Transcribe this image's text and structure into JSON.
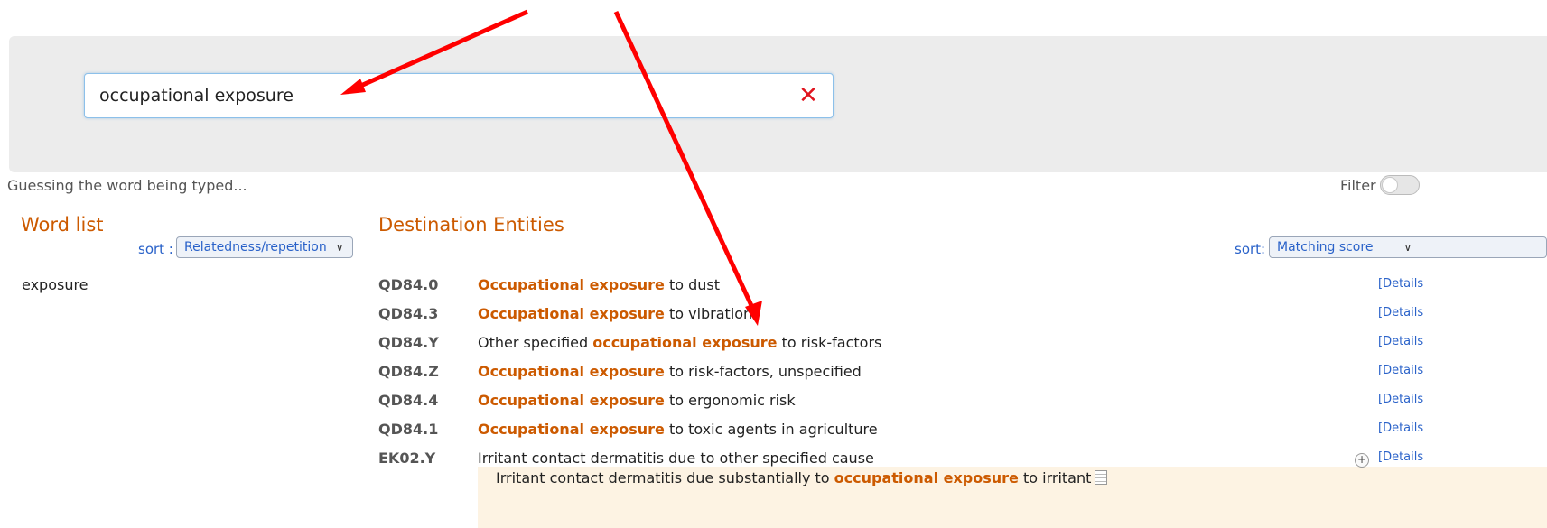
{
  "search": {
    "value": "occupational exposure",
    "clear_icon": "close-icon",
    "clear_glyph": "✕"
  },
  "status": {
    "guess_text": "Guessing the word being typed..."
  },
  "filter": {
    "label": "Filter",
    "enabled": false
  },
  "word_list": {
    "title": "Word list",
    "sort_label": "sort :",
    "sort_value": "Relatedness/repetition",
    "items": [
      "exposure"
    ]
  },
  "entities": {
    "title": "Destination Entities",
    "sort_label": "sort:",
    "sort_value": "Matching score",
    "details_label": "[Details",
    "rows": [
      {
        "code": "QD84.0",
        "pre": "",
        "hl": "Occupational exposure",
        "post": " to dust"
      },
      {
        "code": "QD84.3",
        "pre": "",
        "hl": "Occupational exposure",
        "post": " to vibration"
      },
      {
        "code": "QD84.Y",
        "pre": "Other specified ",
        "hl": "occupational exposure",
        "post": " to risk-factors"
      },
      {
        "code": "QD84.Z",
        "pre": "",
        "hl": "Occupational exposure",
        "post": " to risk-factors, unspecified"
      },
      {
        "code": "QD84.4",
        "pre": "",
        "hl": "Occupational exposure",
        "post": " to ergonomic risk"
      },
      {
        "code": "QD84.1",
        "pre": "",
        "hl": "Occupational exposure",
        "post": " to toxic agents in agriculture"
      },
      {
        "code": "EK02.Y",
        "pre": "Irritant contact dermatitis due to other specified cause",
        "hl": "",
        "post": ""
      }
    ],
    "sub_row": {
      "pre": "Irritant contact dermatitis due substantially to ",
      "hl": "occupational exposure",
      "post": " to irritant"
    }
  },
  "colors": {
    "accent": "#cc5a00",
    "link": "#2a62c9",
    "annotation_arrow": "#ff0000"
  }
}
